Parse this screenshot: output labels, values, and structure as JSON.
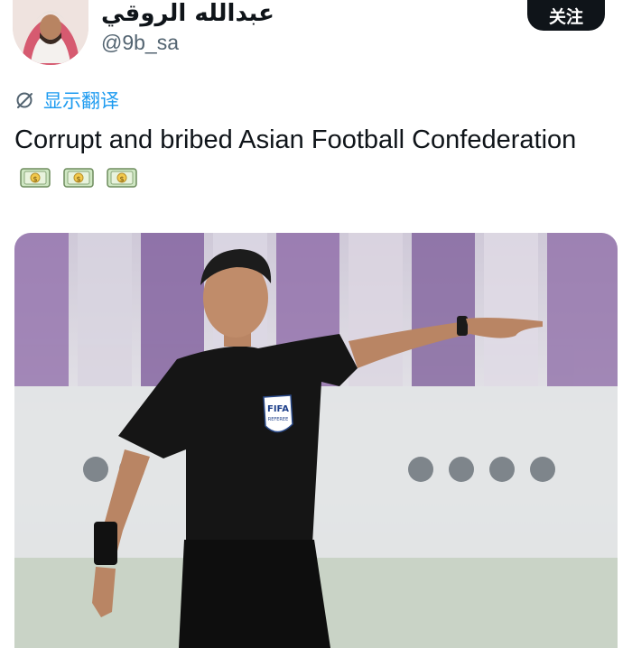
{
  "author": {
    "display_name": "عبدالله الروقي",
    "handle": "@9b_sa"
  },
  "follow_button": {
    "label": "关注"
  },
  "translate": {
    "label": "显示翻译",
    "icon": "globe-icon"
  },
  "tweet": {
    "text": "Corrupt and bribed Asian Football Confederation",
    "emoji": [
      "money-bag-icon",
      "money-bag-icon",
      "money-bag-icon"
    ]
  },
  "media": {
    "badge_text": "FIFA",
    "badge_sub": "REFEREE"
  },
  "colors": {
    "accent": "#1d9bf0",
    "button_bg": "#0f1419",
    "stadium_purple": "#6e4a8c"
  }
}
